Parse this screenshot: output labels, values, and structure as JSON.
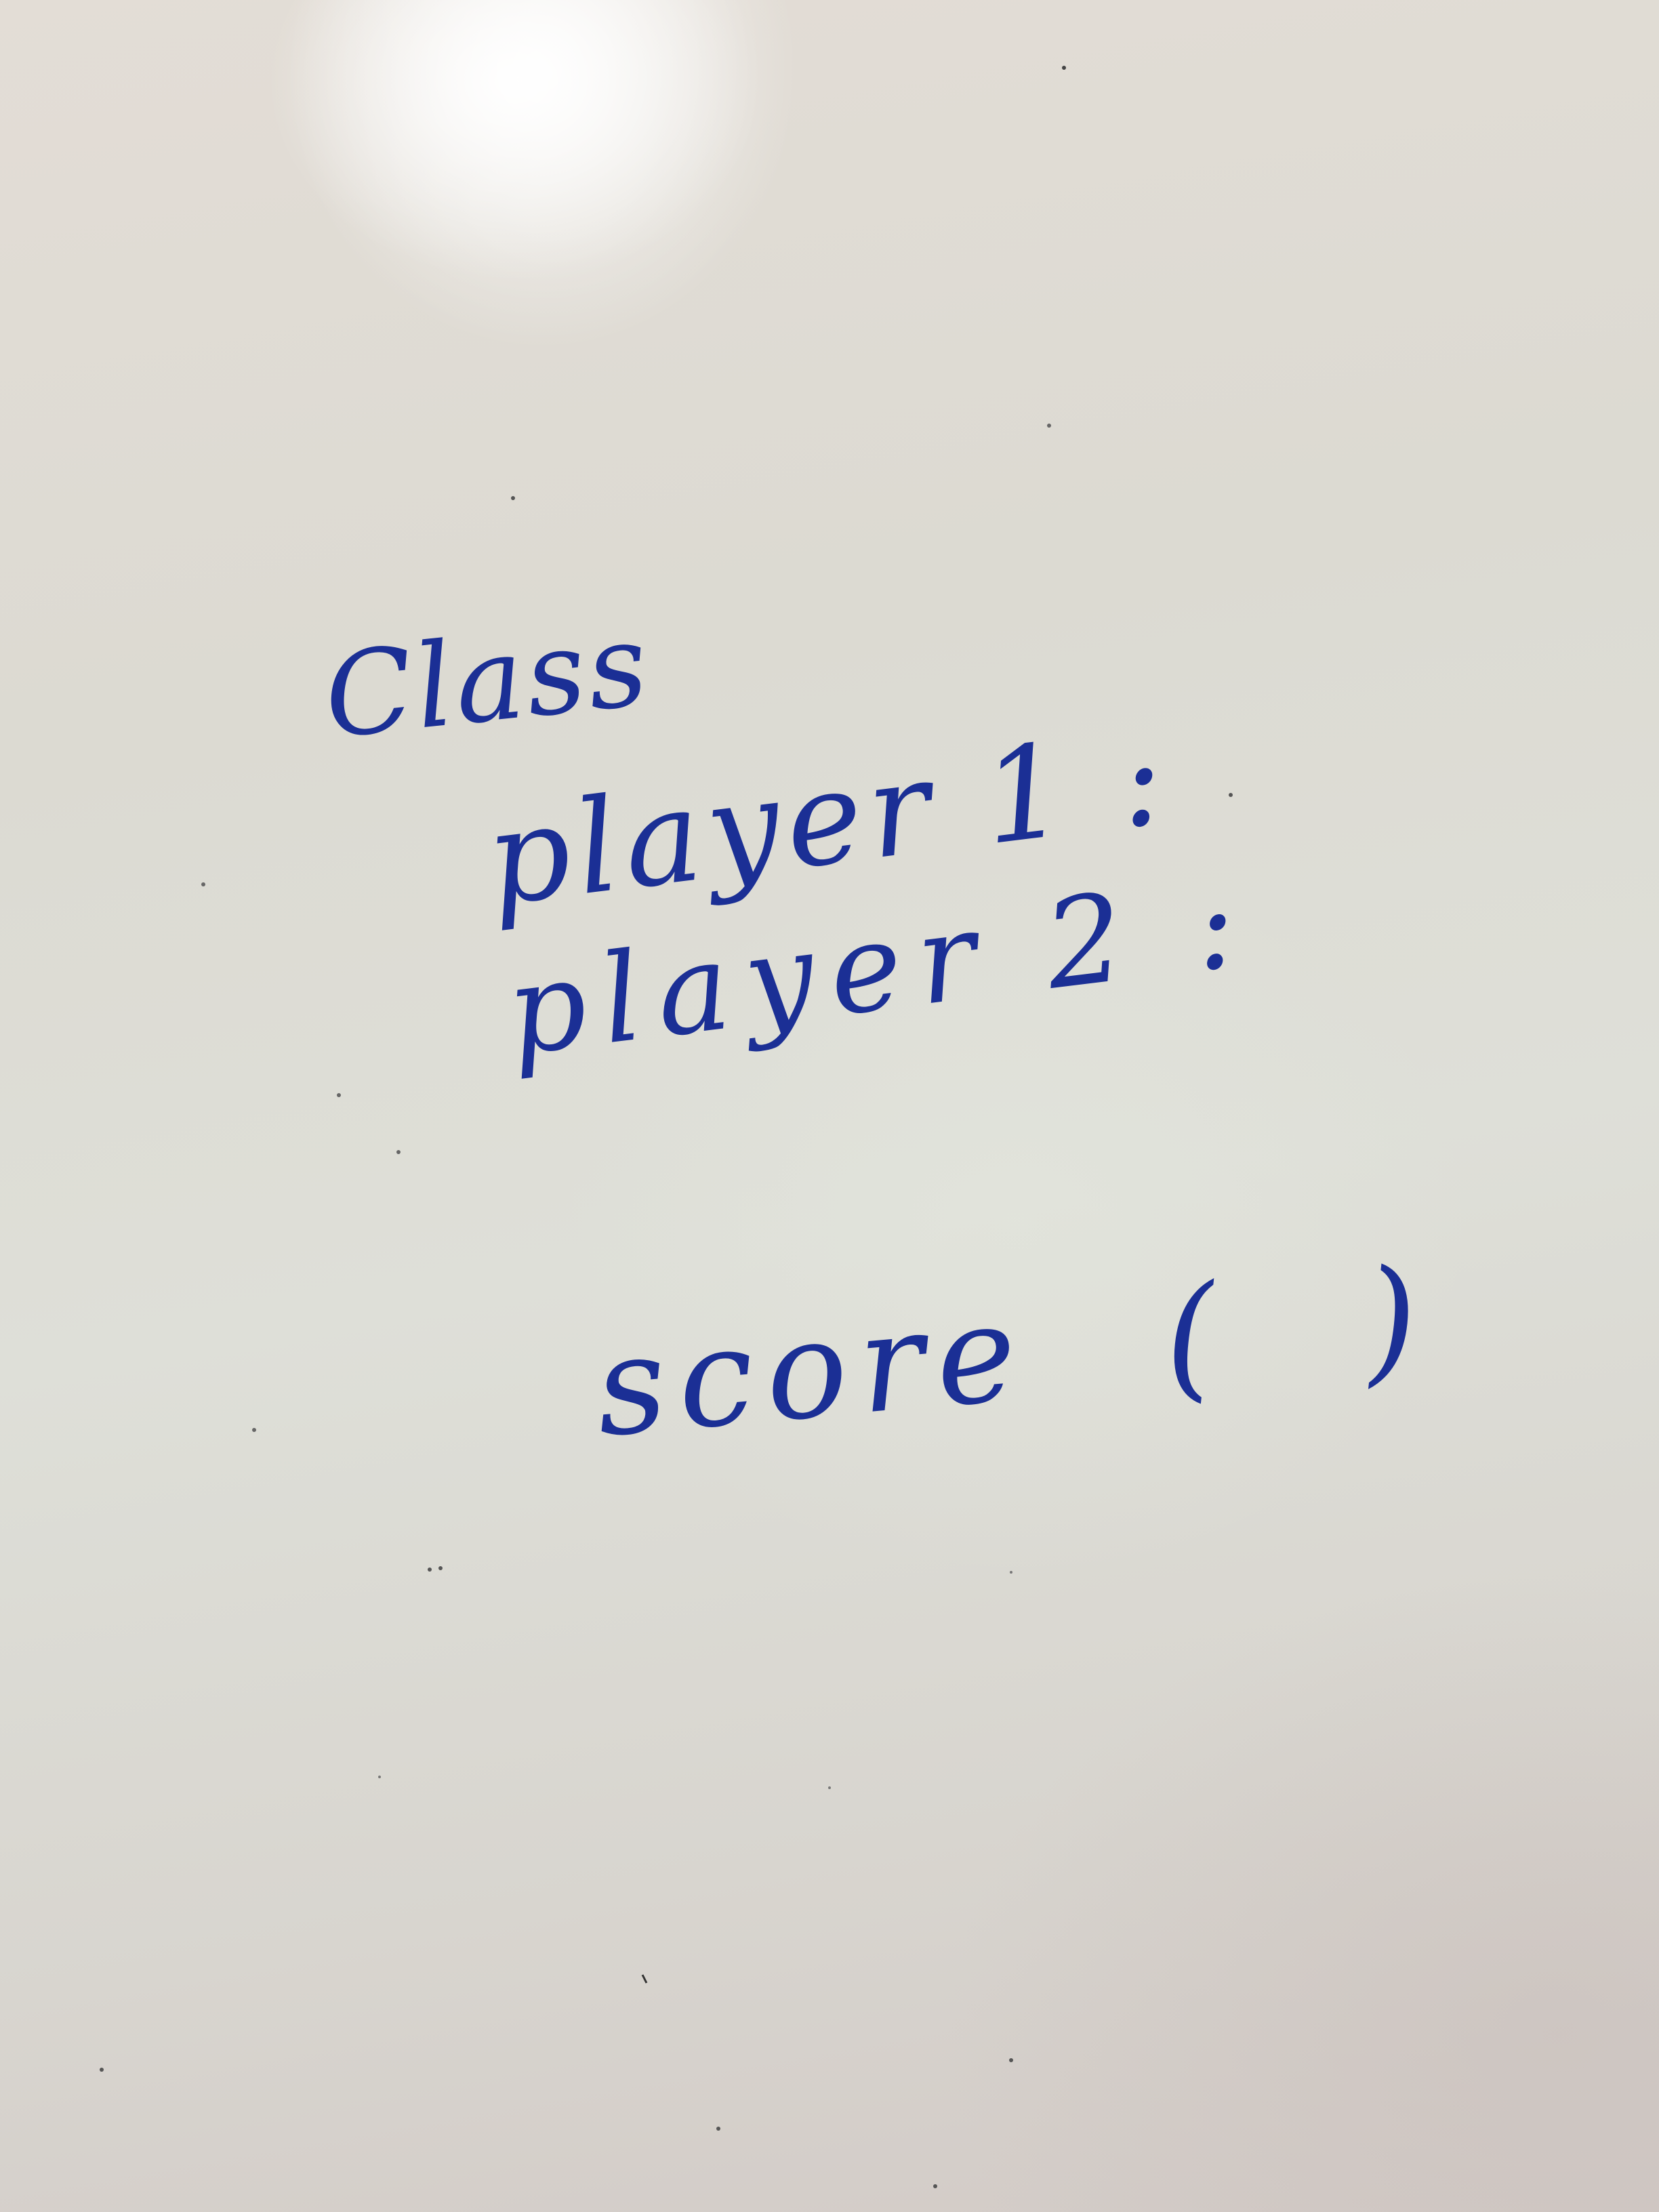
{
  "whiteboard": {
    "ink_color": "#1b2f95",
    "lines": {
      "heading": "Class",
      "player_1": "player 1 :",
      "player_2": "player 2 :",
      "method": "score ( )"
    }
  }
}
